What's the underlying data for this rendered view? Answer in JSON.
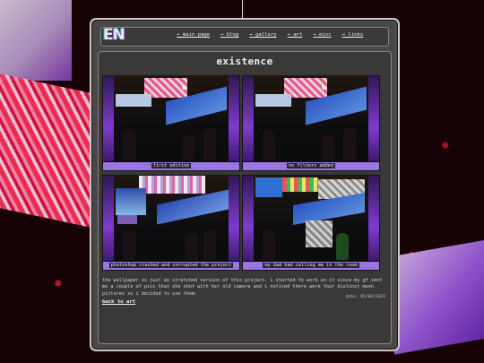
{
  "logo": "EN",
  "nav": [
    {
      "label": "→ main page"
    },
    {
      "label": "→ blog"
    },
    {
      "label": "→ gallery"
    },
    {
      "label": "→ art"
    },
    {
      "label": "→ misc"
    },
    {
      "label": "→ links"
    }
  ],
  "page": {
    "title": "existence",
    "gallery": [
      {
        "caption": "first edition"
      },
      {
        "caption": "no filters added"
      },
      {
        "caption": "photoshop crashed and corrupted the project"
      },
      {
        "caption": "my dad had calling me in the room"
      }
    ],
    "description": "the wallpaper is just an stretched version of this project. i started to work on it since my gf sent me a couple of pics that she shot with her old camera and i noticed there were four distinct moon pictures so i decided to use them.",
    "back_link": "back to art",
    "date": "date: 01/03/2023"
  },
  "colors": {
    "window_bg": "#4a4747",
    "content_bg": "#3b3838",
    "caption_bar": "#9a76e0",
    "wallpaper_red": "#c0142a"
  }
}
